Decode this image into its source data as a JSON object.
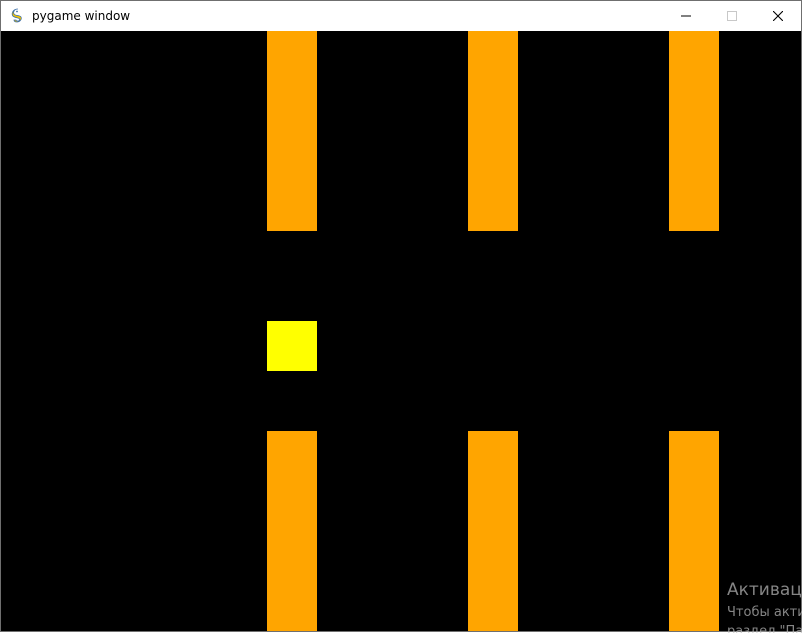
{
  "window": {
    "title": "pygame window",
    "icon": "pygame-snake-icon",
    "controls": {
      "minimize_icon": "minimize-icon",
      "maximize_icon": "maximize-icon",
      "close_icon": "close-icon"
    }
  },
  "game": {
    "background_color": "#000000",
    "pipe_color": "#ffa500",
    "player_color": "#ffff00"
  },
  "watermark": {
    "title": "Активац",
    "line1": "Чтобы акти",
    "line2": "раздел \"Па"
  }
}
